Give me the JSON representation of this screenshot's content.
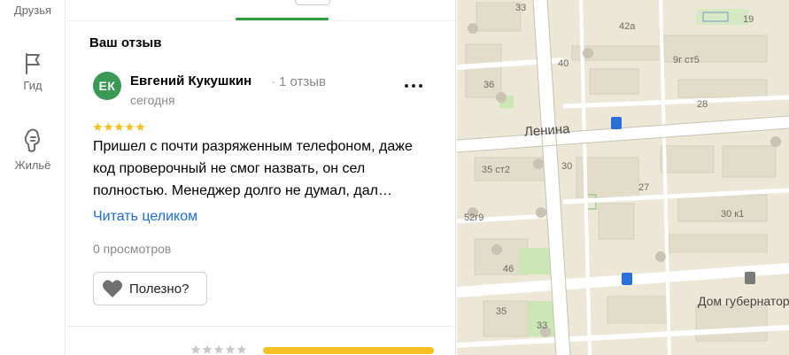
{
  "nav": {
    "friends": "Друзья",
    "guide": "Гид",
    "housing": "Жильё"
  },
  "review": {
    "section_title": "Ваш отзыв",
    "avatar_initials": "ЕК",
    "avatar_color": "#3a9a53",
    "author": "Евгений Кукушкин",
    "author_meta": "1 отзыв",
    "date": "сегодня",
    "rating": 5,
    "text": "Пришел с почти разряженным телефоном, даже код проверочный не смог назвать, он сел полностью. Менеджер долго не думал, дал…",
    "read_more": "Читать целиком",
    "views": "0 просмотров",
    "useful_label": "Полезно?"
  },
  "map": {
    "street": "Ленина",
    "poi": "Дом губернатора",
    "house_numbers": [
      "33",
      "42а",
      "19",
      "40",
      "9г ст5",
      "36",
      "28",
      "35 ст2",
      "30",
      "27",
      "52г9",
      "30 к1",
      "46",
      "35",
      "33"
    ]
  },
  "colors": {
    "accent_green": "#2e9e3c",
    "star": "#f6c122",
    "link": "#1d6ed8"
  }
}
